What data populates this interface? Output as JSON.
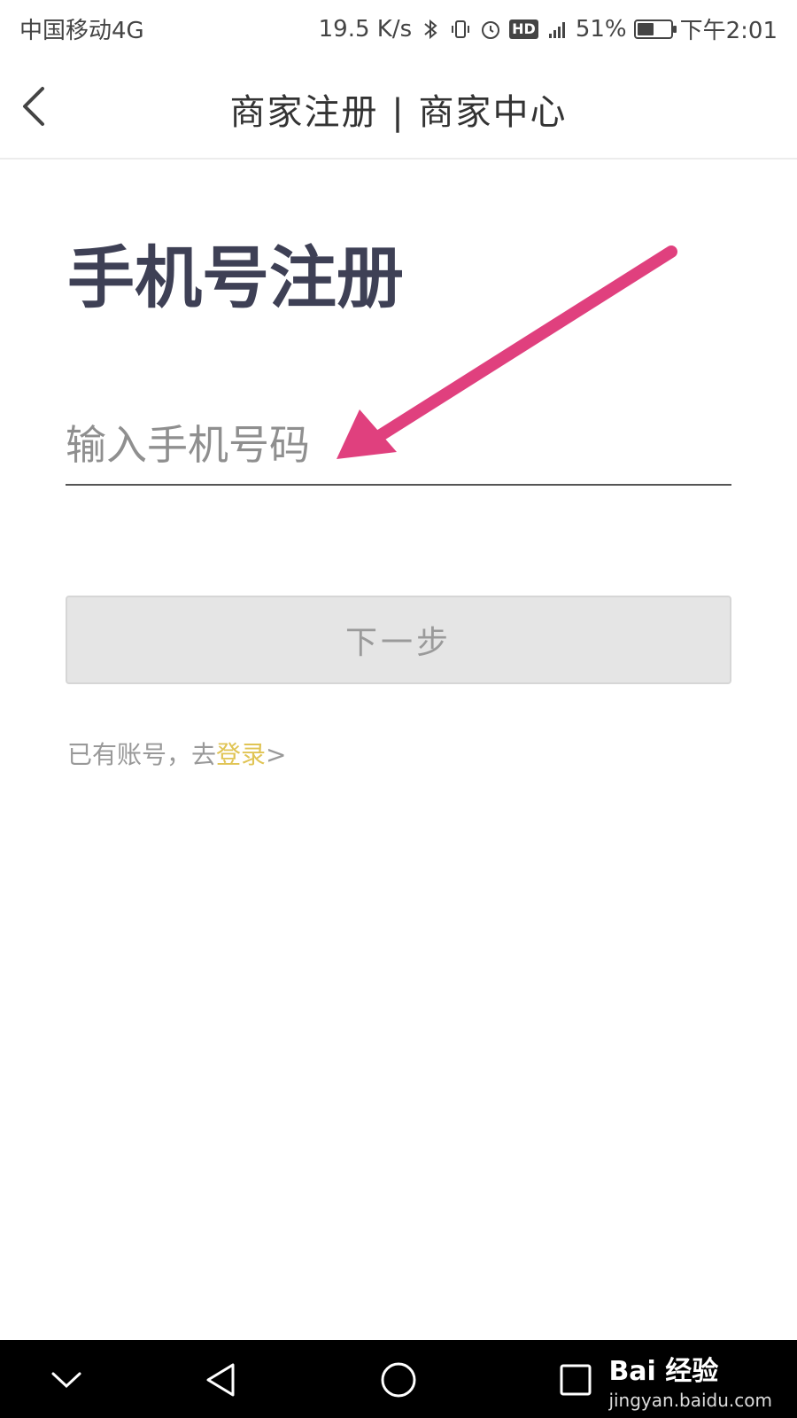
{
  "status_bar": {
    "carrier": "中国移动4G",
    "net_speed": "19.5 K/s",
    "hd": "HD",
    "network": "4G",
    "battery_text": "51%",
    "battery_level": 0.51,
    "time": "下午2:01"
  },
  "nav": {
    "title": "商家注册 | 商家中心",
    "back_icon": "chevron-left-icon"
  },
  "form": {
    "heading": "手机号注册",
    "phone_placeholder": "输入手机号码",
    "phone_value": "",
    "next_label": "下一步",
    "login_prompt": "已有账号，去",
    "login_link": "登录",
    "login_arrow": ">"
  },
  "annotation": {
    "arrow_color": "#e0407e"
  },
  "system_nav": {
    "icons": [
      "chevron-down-icon",
      "back-triangle-icon",
      "home-circle-icon",
      "recents-square-icon"
    ]
  },
  "watermark": {
    "brand": "Bai 经验",
    "url": "jingyan.baidu.com"
  },
  "colors": {
    "title_text": "#3e4055",
    "link": "#e0c454",
    "button_bg": "#e5e5e5"
  }
}
